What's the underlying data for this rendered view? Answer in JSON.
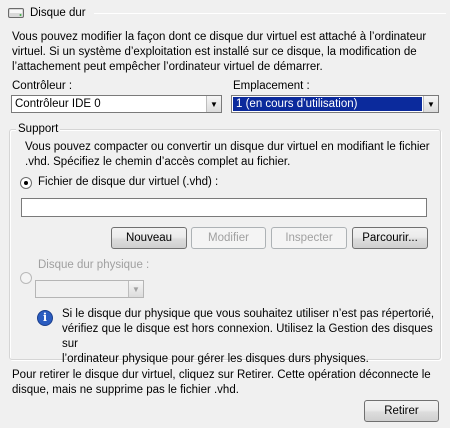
{
  "section": {
    "title": "Disque dur"
  },
  "intro": {
    "line1": "Vous pouvez modifier la façon dont ce disque dur virtuel est attaché à l’ordinateur",
    "line2": "virtuel. Si un système d’exploitation est installé sur ce disque, la modification de",
    "line3": "l’attachement peut empêcher l’ordinateur virtuel de démarrer."
  },
  "controller": {
    "label": "Contrôleur :",
    "value": "Contrôleur IDE 0"
  },
  "location": {
    "label": "Emplacement :",
    "value": "1 (en cours d’utilisation)"
  },
  "support": {
    "legend": "Support",
    "desc_line1": "Vous pouvez compacter ou convertir un disque dur virtuel en modifiant le fichier",
    "desc_line2": ".vhd. Spécifiez le chemin d’accès complet au fichier.",
    "vhd_radio_label": "Fichier de disque dur virtuel (.vhd) :",
    "vhd_path_value": "",
    "buttons": {
      "new": "Nouveau",
      "edit": "Modifier",
      "inspect": "Inspecter",
      "browse": "Parcourir..."
    },
    "physical_radio_label": "Disque dur physique :",
    "physical_select_value": "",
    "info": {
      "line1": "Si le disque dur physique que vous souhaitez utiliser n’est pas répertorié,",
      "line2": "vérifiez que le disque est hors connexion. Utilisez la Gestion des disques sur",
      "line3": "l’ordinateur physique pour gérer les disques durs physiques."
    }
  },
  "remove": {
    "line1": "Pour retirer le disque dur virtuel, cliquez sur Retirer. Cette opération déconnecte le",
    "line2": "disque, mais ne supprime pas le fichier .vhd.",
    "button": "Retirer"
  }
}
